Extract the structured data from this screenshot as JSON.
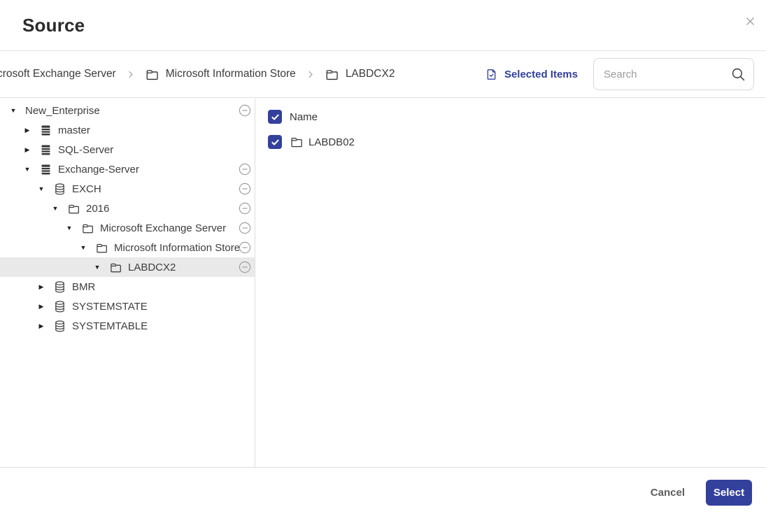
{
  "dialog": {
    "title": "Source"
  },
  "breadcrumb": {
    "items": [
      {
        "label": "crosoft Exchange Server",
        "icon": "none"
      },
      {
        "label": "Microsoft Information Store",
        "icon": "folder-icon"
      },
      {
        "label": "LABDCX2",
        "icon": "folder-icon"
      }
    ]
  },
  "toolbar": {
    "selected_items_label": "Selected Items",
    "search_placeholder": "Search"
  },
  "tree": {
    "items": [
      {
        "label": "New_Enterprise",
        "level": 0,
        "expanded": true,
        "icon": "none",
        "selected": false
      },
      {
        "label": "master",
        "level": 1,
        "expanded": false,
        "icon": "server",
        "selected": false
      },
      {
        "label": "SQL-Server",
        "level": 1,
        "expanded": false,
        "icon": "server",
        "selected": false
      },
      {
        "label": "Exchange-Server",
        "level": 1,
        "expanded": true,
        "icon": "server",
        "selected": false
      },
      {
        "label": "EXCH",
        "level": 2,
        "expanded": true,
        "icon": "database",
        "selected": false
      },
      {
        "label": "2016",
        "level": 3,
        "expanded": true,
        "icon": "folder",
        "selected": false
      },
      {
        "label": "Microsoft Exchange Server",
        "level": 4,
        "expanded": true,
        "icon": "folder",
        "selected": false
      },
      {
        "label": "Microsoft Information Store",
        "level": 5,
        "expanded": true,
        "icon": "folder",
        "selected": false
      },
      {
        "label": "LABDCX2",
        "level": 6,
        "expanded": true,
        "icon": "folder",
        "selected": true
      },
      {
        "label": "BMR",
        "level": 2,
        "expanded": false,
        "icon": "database",
        "selected": false
      },
      {
        "label": "SYSTEMSTATE",
        "level": 2,
        "expanded": false,
        "icon": "database",
        "selected": false
      },
      {
        "label": "SYSTEMTABLE",
        "level": 2,
        "expanded": false,
        "icon": "database",
        "selected": false
      }
    ]
  },
  "panel": {
    "header": {
      "label": "Name",
      "checked": true
    },
    "rows": [
      {
        "label": "LABDB02",
        "icon": "folder-icon",
        "checked": true
      }
    ]
  },
  "footer": {
    "cancel_label": "Cancel",
    "select_label": "Select"
  },
  "colors": {
    "accent": "#33409c",
    "selected_row": "#e9e9e9",
    "border": "#dedede"
  }
}
